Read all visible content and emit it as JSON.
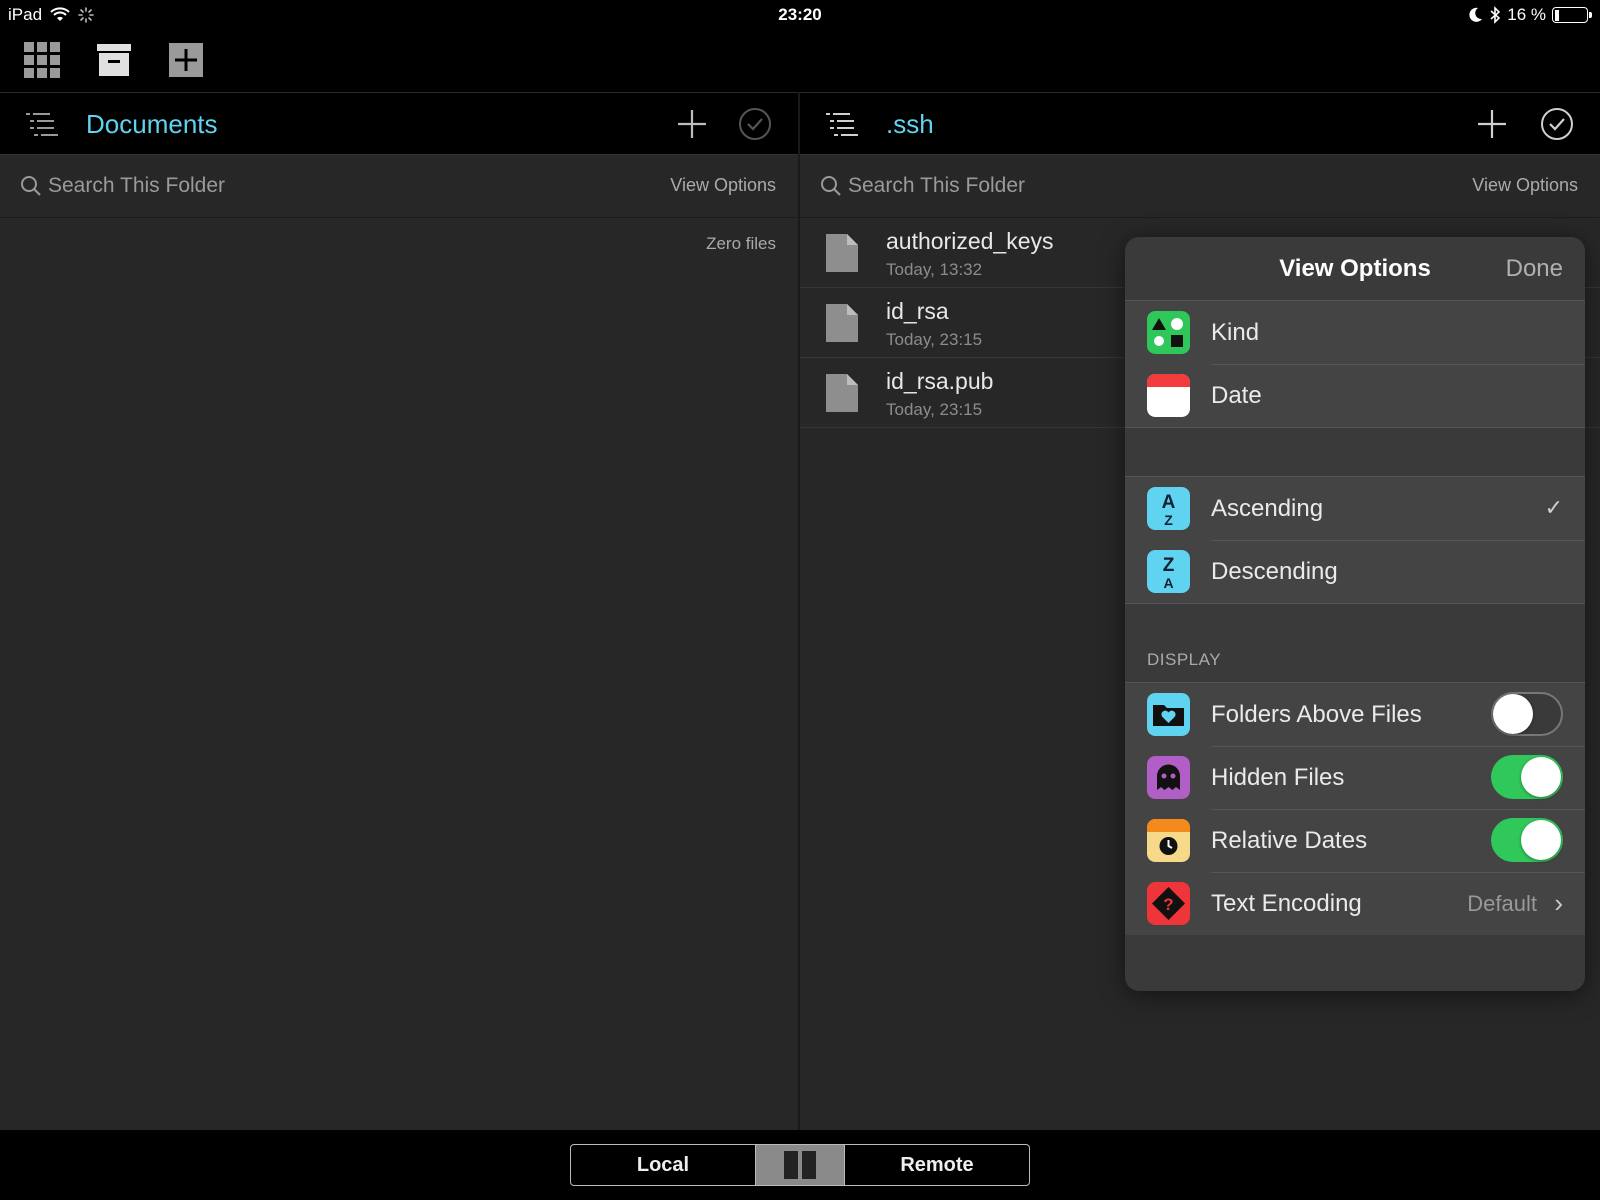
{
  "status": {
    "device": "iPad",
    "time": "23:20",
    "battery": "16 %",
    "battery_level": 0.16
  },
  "left_pane": {
    "title": "Documents",
    "search_placeholder": "Search This Folder",
    "view_options": "View Options",
    "empty_text": "Zero files"
  },
  "right_pane": {
    "title": ".ssh",
    "search_placeholder": "Search This Folder",
    "view_options": "View Options",
    "files": [
      {
        "name": "authorized_keys",
        "date": "Today, 13:32"
      },
      {
        "name": "id_rsa",
        "date": "Today, 23:15"
      },
      {
        "name": "id_rsa.pub",
        "date": "Today, 23:15"
      }
    ]
  },
  "popover": {
    "title": "View Options",
    "done": "Done",
    "sort_by": [
      {
        "label": "Kind",
        "icon": "kind-icon"
      },
      {
        "label": "Date",
        "icon": "calendar-icon"
      }
    ],
    "order": [
      {
        "label": "Ascending",
        "icon": "ascending-icon",
        "selected": true,
        "check": "✓"
      },
      {
        "label": "Descending",
        "icon": "descending-icon",
        "selected": false
      }
    ],
    "display_header": "DISPLAY",
    "display": {
      "folders_above_files": {
        "label": "Folders Above Files",
        "on": false
      },
      "hidden_files": {
        "label": "Hidden Files",
        "on": true
      },
      "relative_dates": {
        "label": "Relative Dates",
        "on": true
      },
      "text_encoding": {
        "label": "Text Encoding",
        "value": "Default"
      }
    }
  },
  "bottom": {
    "local": "Local",
    "remote": "Remote"
  },
  "colors": {
    "accent": "#5fd3f0",
    "toggle_on": "#30c85a",
    "pane_bg": "#272727",
    "popover_bg": "#3a3a3a"
  }
}
